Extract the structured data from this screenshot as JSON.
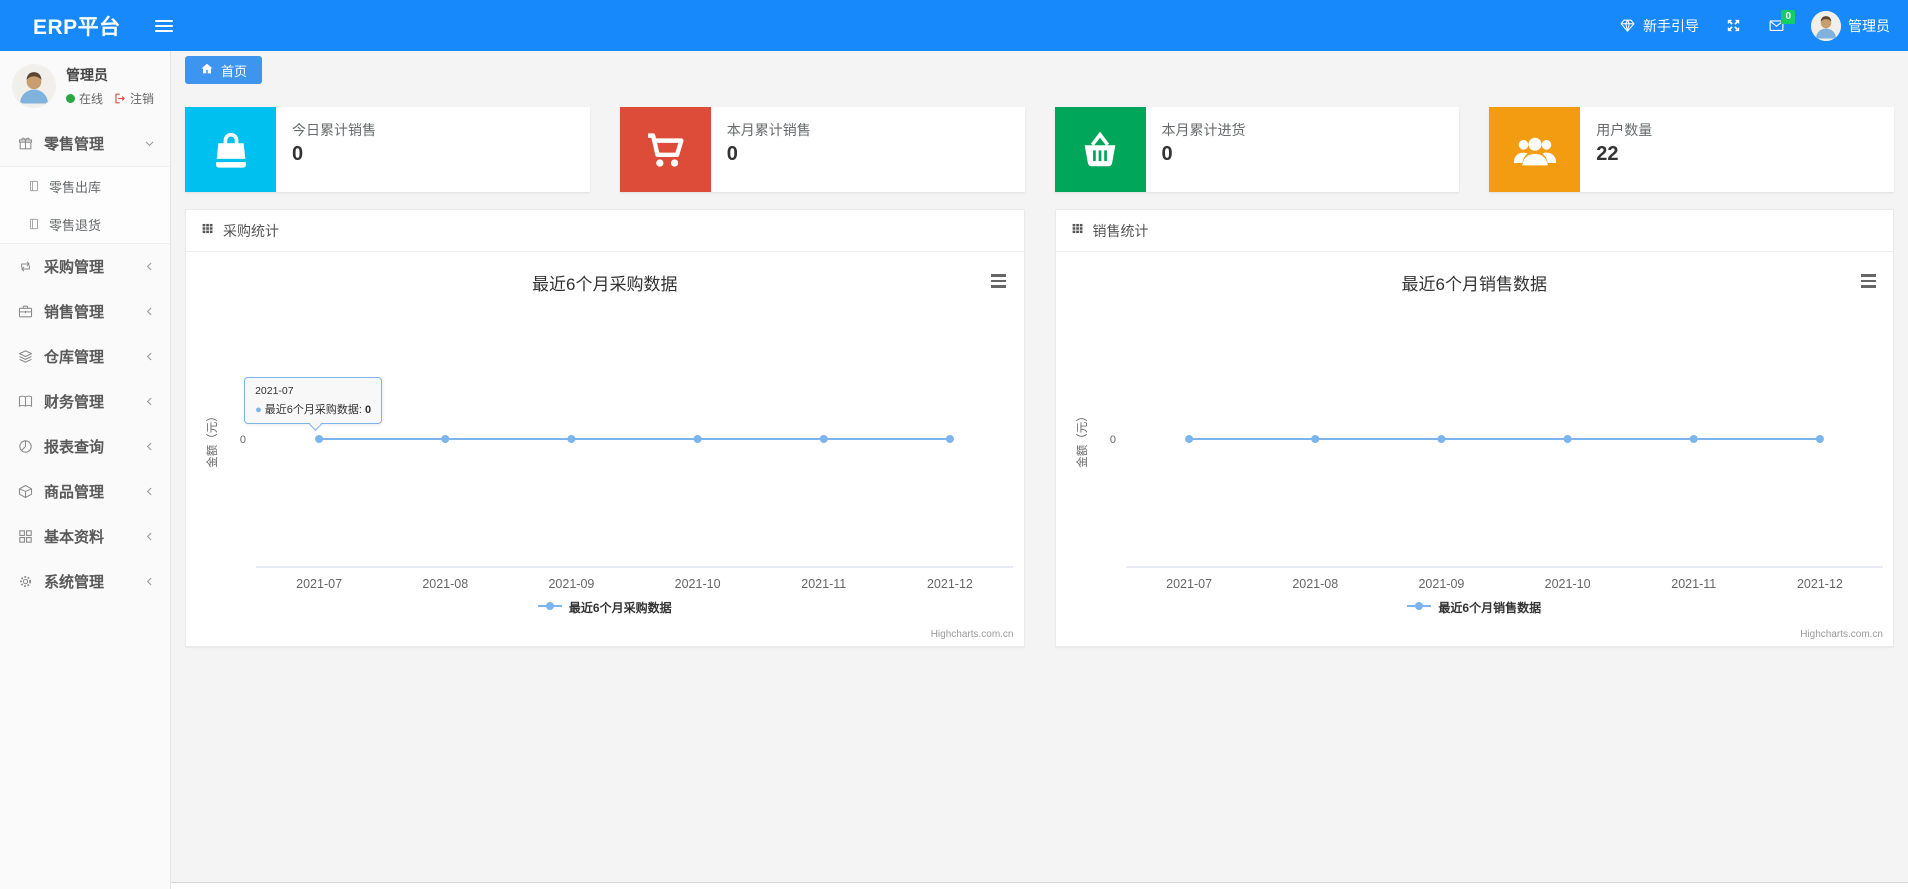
{
  "colors": {
    "brand": "#1889fa",
    "tab": "#3d95f0",
    "chart_line": "#7cb5ec",
    "badge_green": "#13ce66",
    "status_green": "#28a745",
    "logout_red": "#d9534f"
  },
  "navbar": {
    "brand": "ERP平台",
    "guide_label": "新手引导",
    "message_badge": "0",
    "username": "管理员"
  },
  "sidebar": {
    "user": {
      "name": "管理员",
      "status_label": "在线",
      "logout_label": "注销"
    },
    "menu": [
      {
        "id": "retail-management",
        "label": "零售管理",
        "icon": "gift-icon",
        "state": "expanded",
        "children": [
          {
            "id": "retail-outbound",
            "label": "零售出库",
            "icon": "doc-icon"
          },
          {
            "id": "retail-return",
            "label": "零售退货",
            "icon": "doc-icon"
          }
        ]
      },
      {
        "id": "purchase-management",
        "label": "采购管理",
        "icon": "loop-icon",
        "state": "collapsed"
      },
      {
        "id": "sales-management",
        "label": "销售管理",
        "icon": "briefcase-icon",
        "state": "collapsed"
      },
      {
        "id": "warehouse-management",
        "label": "仓库管理",
        "icon": "layers-icon",
        "state": "collapsed"
      },
      {
        "id": "finance-management",
        "label": "财务管理",
        "icon": "book-icon",
        "state": "collapsed"
      },
      {
        "id": "report-query",
        "label": "报表查询",
        "icon": "pie-chart-icon",
        "state": "collapsed"
      },
      {
        "id": "goods-management",
        "label": "商品管理",
        "icon": "box-icon",
        "state": "collapsed"
      },
      {
        "id": "basic-data",
        "label": "基本资料",
        "icon": "grid-icon",
        "state": "collapsed"
      },
      {
        "id": "system-management",
        "label": "系统管理",
        "icon": "gear-icon",
        "state": "collapsed"
      }
    ]
  },
  "tabs": [
    {
      "id": "home",
      "label": "首页",
      "active": true
    }
  ],
  "stats": [
    {
      "id": "today-sales",
      "label": "今日累计销售",
      "value": "0",
      "color": "#00c0ef",
      "icon": "shopping-bag-icon"
    },
    {
      "id": "month-sales",
      "label": "本月累计销售",
      "value": "0",
      "color": "#dd4b39",
      "icon": "cart-icon"
    },
    {
      "id": "month-purchase",
      "label": "本月累计进货",
      "value": "0",
      "color": "#00a65a",
      "icon": "basket-icon"
    },
    {
      "id": "user-count",
      "label": "用户数量",
      "value": "22",
      "color": "#f39c12",
      "icon": "users-icon"
    }
  ],
  "panels": [
    {
      "id": "purchase-stats",
      "title": "采购统计"
    },
    {
      "id": "sales-stats",
      "title": "销售统计"
    }
  ],
  "chart_data": [
    {
      "type": "line",
      "title": "最近6个月采购数据",
      "categories": [
        "2021-07",
        "2021-08",
        "2021-09",
        "2021-10",
        "2021-11",
        "2021-12"
      ],
      "series": [
        {
          "name": "最近6个月采购数据",
          "values": [
            0,
            0,
            0,
            0,
            0,
            0
          ],
          "color": "#7cb5ec"
        }
      ],
      "xlabel": "",
      "ylabel": "金额（元）",
      "y_ticks": [
        "0"
      ],
      "ylim": [
        0,
        0
      ],
      "grid": false,
      "legend_position": "bottom",
      "credits": "Highcharts.com.cn",
      "tooltip": {
        "visible": true,
        "category": "2021-07",
        "series_label": "最近6个月采购数据: ",
        "value": "0"
      }
    },
    {
      "type": "line",
      "title": "最近6个月销售数据",
      "categories": [
        "2021-07",
        "2021-08",
        "2021-09",
        "2021-10",
        "2021-11",
        "2021-12"
      ],
      "series": [
        {
          "name": "最近6个月销售数据",
          "values": [
            0,
            0,
            0,
            0,
            0,
            0
          ],
          "color": "#7cb5ec"
        }
      ],
      "xlabel": "",
      "ylabel": "金额（元）",
      "y_ticks": [
        "0"
      ],
      "ylim": [
        0,
        0
      ],
      "grid": false,
      "legend_position": "bottom",
      "credits": "Highcharts.com.cn",
      "tooltip": {
        "visible": false
      }
    }
  ]
}
